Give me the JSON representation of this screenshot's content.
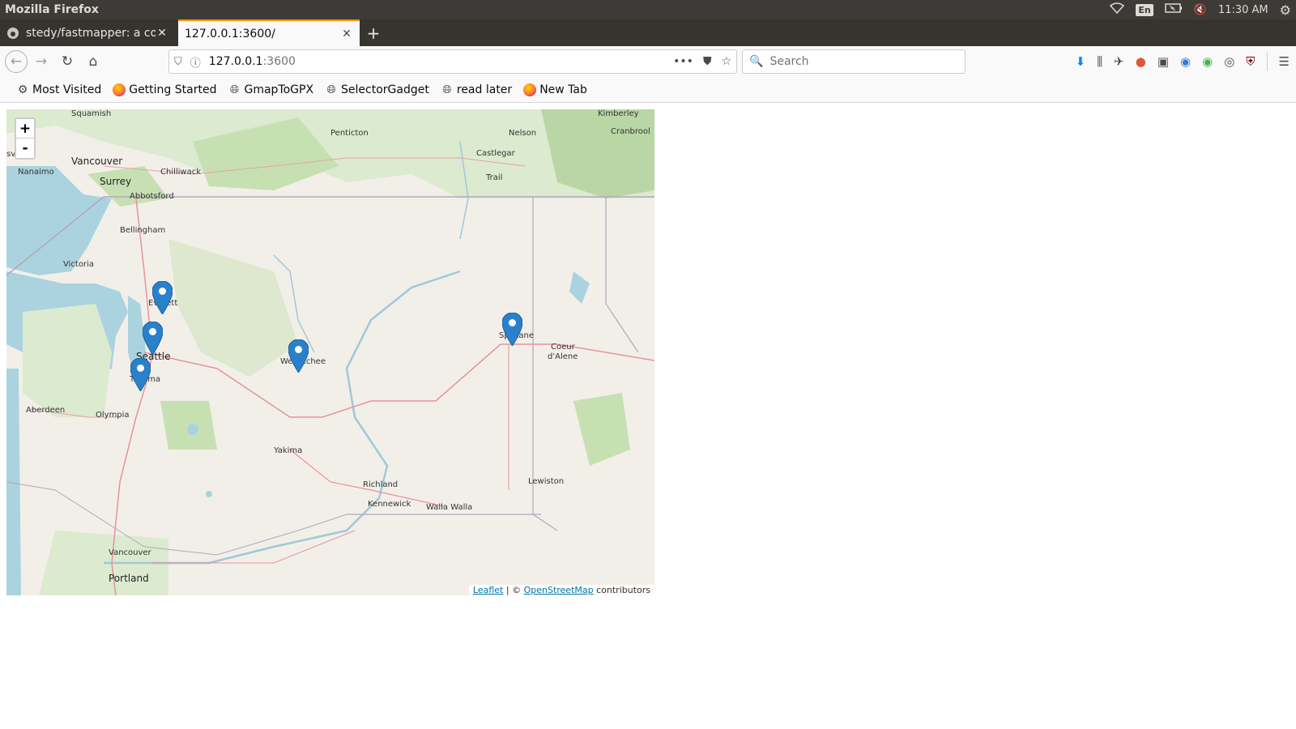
{
  "os_bar": {
    "app_title": "Mozilla Firefox",
    "lang": "En",
    "clock": "11:30 AM"
  },
  "tabs": [
    {
      "label": "stedy/fastmapper: a con",
      "active": false
    },
    {
      "label": "127.0.0.1:3600/",
      "active": true
    }
  ],
  "url": {
    "host": "127.0.0.1",
    "port": ":3600"
  },
  "search": {
    "placeholder": "Search"
  },
  "bookmarks": [
    {
      "label": "Most Visited",
      "icon": "gear-icon"
    },
    {
      "label": "Getting Started",
      "icon": "firefox-icon"
    },
    {
      "label": "GmapToGPX",
      "icon": "globe-icon"
    },
    {
      "label": "SelectorGadget",
      "icon": "globe-icon"
    },
    {
      "label": "read later",
      "icon": "globe-icon"
    },
    {
      "label": "New Tab",
      "icon": "firefox-icon"
    }
  ],
  "map": {
    "zoom_in": "+",
    "zoom_out": "-",
    "attribution": {
      "leaflet": "Leaflet",
      "sep": " | © ",
      "osm": "OpenStreetMap",
      "suffix": " contributors"
    },
    "cities": {
      "squamish": "Squamish",
      "penticton": "Penticton",
      "nelson": "Nelson",
      "kimberley": "Kimberley",
      "cranbrook": "Cranbrool",
      "castlegar": "Castlegar",
      "trail": "Trail",
      "vancouver_bc": "Vancouver",
      "nanaimo": "Nanaimo",
      "surrey": "Surrey",
      "chilliwack": "Chilliwack",
      "abbotsford": "Abbotsford",
      "bellingham": "Bellingham",
      "victoria": "Victoria",
      "everett": "Everett",
      "seattle": "Seattle",
      "tacoma": "Tacoma",
      "wenatchee": "Wenatchee",
      "spokane": "Spokane",
      "coeur": "Coeur",
      "dalene": "d'Alene",
      "aberdeen": "Aberdeen",
      "olympia": "Olympia",
      "yakima": "Yakima",
      "richland": "Richland",
      "kennewick": "Kennewick",
      "walla": "Walla Walla",
      "lewiston": "Lewiston",
      "vancouver_wa": "Vancouver",
      "portland": "Portland",
      "sv": "sv"
    },
    "marker_color": "#2a81cb"
  }
}
